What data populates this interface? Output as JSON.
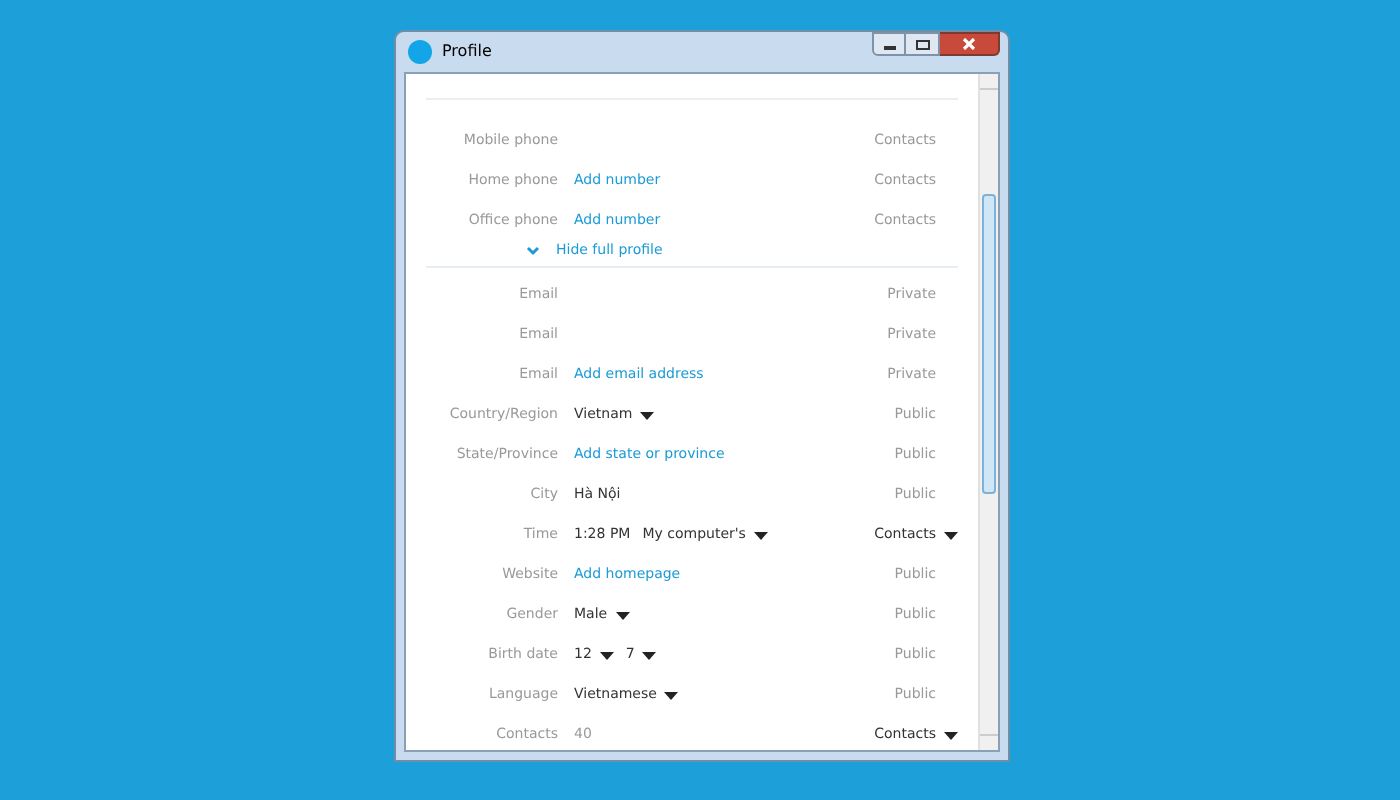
{
  "window": {
    "title": "Profile"
  },
  "phone_rows": [
    {
      "label": "Mobile phone",
      "value": [],
      "privacy": {
        "text": "Contacts",
        "dropdown": false
      }
    },
    {
      "label": "Home phone",
      "value": [
        {
          "kind": "link",
          "text": "Add number"
        }
      ],
      "privacy": {
        "text": "Contacts",
        "dropdown": false
      }
    },
    {
      "label": "Office phone",
      "value": [
        {
          "kind": "link",
          "text": "Add number"
        }
      ],
      "privacy": {
        "text": "Contacts",
        "dropdown": false
      }
    }
  ],
  "toggle": {
    "label": "Hide full profile",
    "expanded": true
  },
  "rows": [
    {
      "label": "Email",
      "value": [],
      "privacy": {
        "text": "Private",
        "dropdown": false
      }
    },
    {
      "label": "Email",
      "value": [],
      "privacy": {
        "text": "Private",
        "dropdown": false
      }
    },
    {
      "label": "Email",
      "value": [
        {
          "kind": "link",
          "text": "Add email address"
        }
      ],
      "privacy": {
        "text": "Private",
        "dropdown": false
      }
    },
    {
      "label": "Country/Region",
      "value": [
        {
          "kind": "dropdown",
          "text": "Vietnam"
        }
      ],
      "privacy": {
        "text": "Public",
        "dropdown": false
      }
    },
    {
      "label": "State/Province",
      "value": [
        {
          "kind": "link",
          "text": "Add state or province"
        }
      ],
      "privacy": {
        "text": "Public",
        "dropdown": false
      }
    },
    {
      "label": "City",
      "value": [
        {
          "kind": "text",
          "text": "Hà Nội"
        }
      ],
      "privacy": {
        "text": "Public",
        "dropdown": false
      }
    },
    {
      "label": "Time",
      "value": [
        {
          "kind": "text",
          "text": "1:28 PM"
        },
        {
          "kind": "dropdown",
          "text": "My computer's"
        }
      ],
      "privacy": {
        "text": "Contacts",
        "dropdown": true
      }
    },
    {
      "label": "Website",
      "value": [
        {
          "kind": "link",
          "text": "Add homepage"
        }
      ],
      "privacy": {
        "text": "Public",
        "dropdown": false
      }
    },
    {
      "label": "Gender",
      "value": [
        {
          "kind": "dropdown",
          "text": "Male"
        }
      ],
      "privacy": {
        "text": "Public",
        "dropdown": false
      }
    },
    {
      "label": "Birth date",
      "value": [
        {
          "kind": "dropdown",
          "text": "12"
        },
        {
          "kind": "dropdown",
          "text": "7"
        }
      ],
      "privacy": {
        "text": "Public",
        "dropdown": false
      }
    },
    {
      "label": "Language",
      "value": [
        {
          "kind": "dropdown",
          "text": "Vietnamese"
        }
      ],
      "privacy": {
        "text": "Public",
        "dropdown": false
      }
    },
    {
      "label": "Contacts",
      "value": [
        {
          "kind": "muted",
          "text": "40"
        }
      ],
      "privacy": {
        "text": "Contacts",
        "dropdown": true
      }
    }
  ]
}
